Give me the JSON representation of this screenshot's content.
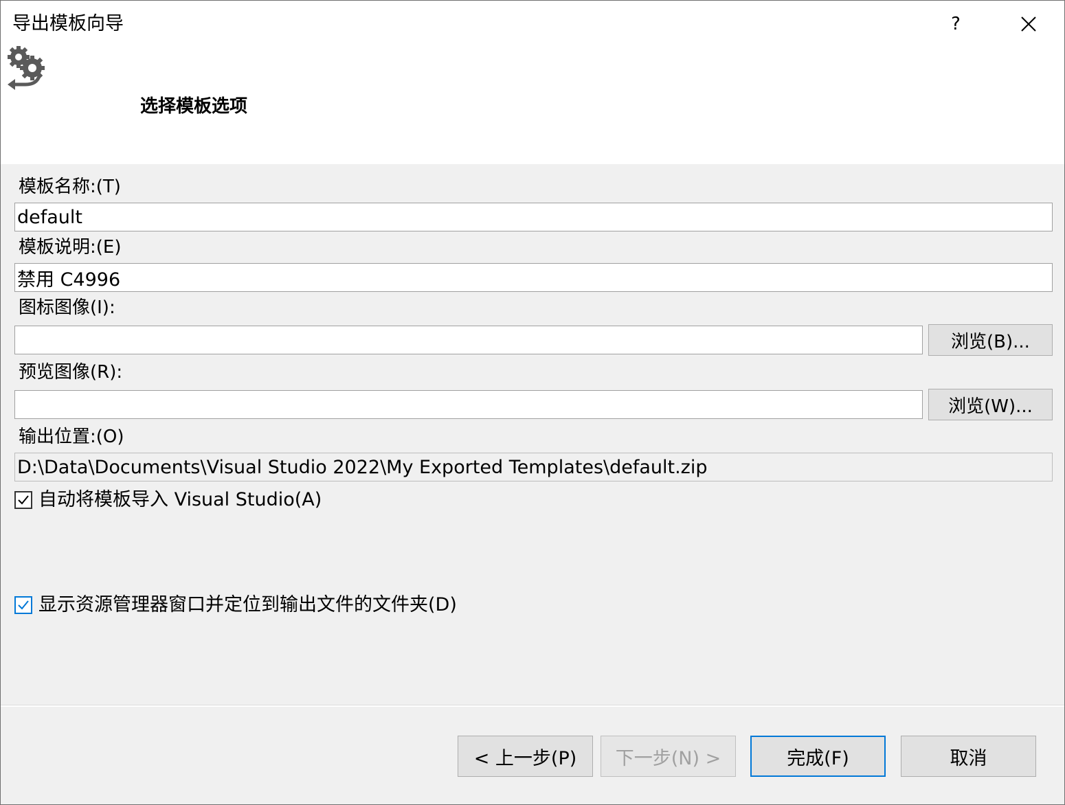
{
  "window": {
    "title": "导出模板向导",
    "help_label": "?"
  },
  "header": {
    "step_title": "选择模板选项",
    "icon": "wizard-gear-arrow-icon"
  },
  "fields": {
    "template_name": {
      "label": "模板名称:(T)",
      "value": "default"
    },
    "template_description": {
      "label": "模板说明:(E)",
      "value": "禁用 C4996"
    },
    "icon_image": {
      "label": "图标图像(I):",
      "value": "",
      "browse_label": "浏览(B)..."
    },
    "preview_image": {
      "label": "预览图像(R):",
      "value": "",
      "browse_label": "浏览(W)..."
    },
    "output_location": {
      "label": "输出位置:(O)",
      "value": "D:\\Data\\Documents\\Visual Studio 2022\\My Exported Templates\\default.zip"
    }
  },
  "options": {
    "auto_import": {
      "label": "自动将模板导入 Visual Studio(A)",
      "checked": true
    },
    "show_explorer": {
      "label": "显示资源管理器窗口并定位到输出文件的文件夹(D)",
      "checked": true
    }
  },
  "footer": {
    "back_label": "< 上一步(P)",
    "next_label": "下一步(N) >",
    "finish_label": "完成(F)",
    "cancel_label": "取消"
  },
  "colors": {
    "accent": "#0078d7",
    "panel": "#f0f0f0",
    "button": "#e1e1e1"
  }
}
